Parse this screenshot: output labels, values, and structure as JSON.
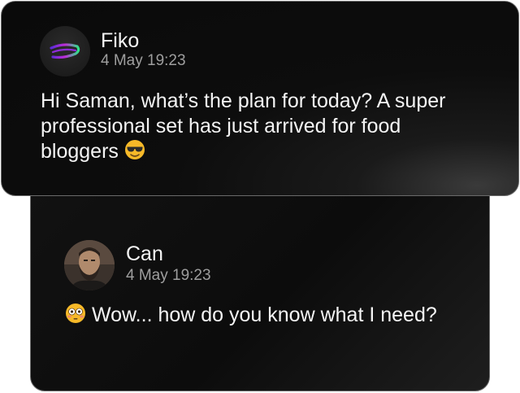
{
  "messages": [
    {
      "sender": "Fiko",
      "time": "4 May 19:23",
      "text": "Hi Saman, what’s the plan for today? A super professional set has just arrived for food bloggers",
      "trailing_emoji": "smiling-face-with-sunglasses"
    },
    {
      "sender": "Can",
      "time": "4 May 19:23",
      "leading_emoji": "flushed-face",
      "text": "Wow... how do you know what I need?"
    }
  ],
  "colors": {
    "card_background": "#0c0c0c",
    "card_border": "#6a6a6a",
    "name_text": "#f5f5f5",
    "time_text": "#9e9e9e",
    "logo_purple": "#8e2cd8",
    "logo_green": "#2ee28a",
    "emoji_yellow": "#f7b928"
  }
}
